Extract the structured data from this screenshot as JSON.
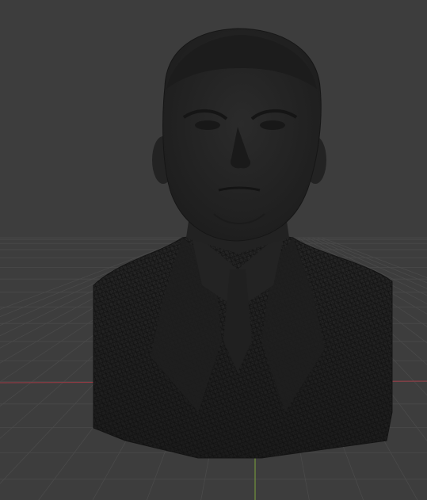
{
  "viewport": {
    "background": "#3d3d3d",
    "grid_color": "#4a4a4a",
    "x_axis_color": "#9b3a44",
    "y_axis_color": "#7aa23a",
    "shading": "solid",
    "overlay": "wireframe"
  },
  "object": {
    "kind": "sculpted bust mesh",
    "icon": "mesh-icon",
    "base_color": "#242424",
    "wire_color": "#111111"
  }
}
